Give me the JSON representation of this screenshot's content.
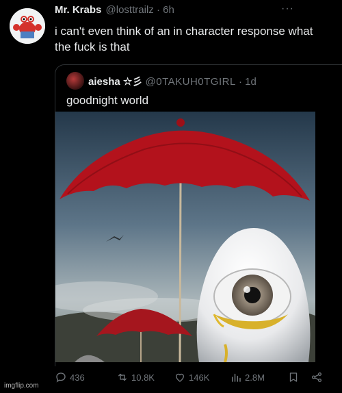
{
  "tweet": {
    "author_name": "Mr. Krabs",
    "author_handle": "@losttrailz",
    "separator": "·",
    "time": "6h",
    "more_label": "···",
    "text": "i can't even think of an in character response what the fuck is that"
  },
  "quote": {
    "author_name": "aiesha ☆彡",
    "author_handle": "@0TAKUH0TGIRL",
    "separator": "·",
    "time": "1d",
    "text": "goodnight world",
    "image_icon": "surreal-eye-egg-umbrella-image"
  },
  "actions": {
    "replies": "436",
    "reposts": "10.8K",
    "likes": "146K",
    "views": "2.8M"
  },
  "watermark": "imgflip.com",
  "colors": {
    "background": "#000000",
    "primary_text": "#e7e9ea",
    "secondary_text": "#71767b",
    "border": "#2f3336",
    "umbrella_red": "#b3121c"
  }
}
